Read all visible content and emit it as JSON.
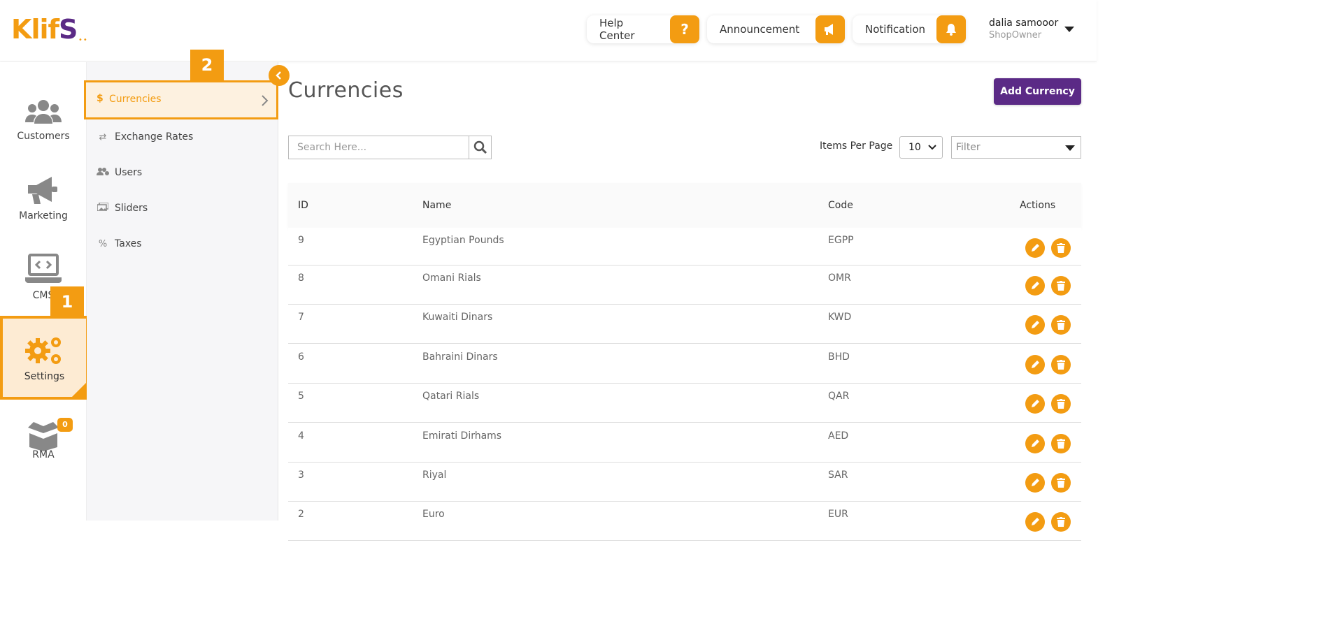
{
  "header": {
    "logo_text": "Klif",
    "logo_s": "S",
    "help_center_label": "Help Center",
    "help_icon_glyph": "?",
    "announcement_label": "Announcement",
    "notification_label": "Notification",
    "user_name": "dalia samooor",
    "user_role": "ShopOwner"
  },
  "rail": {
    "items": [
      {
        "label": "Customers",
        "icon": "users-icon"
      },
      {
        "label": "Marketing",
        "icon": "megaphone-icon"
      },
      {
        "label": "CMS",
        "icon": "laptop-code-icon"
      },
      {
        "label": "Settings",
        "icon": "gears-icon"
      },
      {
        "label": "RMA",
        "icon": "open-box-icon",
        "badge": "0"
      }
    ],
    "selected": "Settings"
  },
  "submenu": {
    "items": [
      {
        "label": "Currencies",
        "icon": "dollar-icon"
      },
      {
        "label": "Exchange Rates",
        "icon": "exchange-icon"
      },
      {
        "label": "Users",
        "icon": "users-cog-icon"
      },
      {
        "label": "Sliders",
        "icon": "images-icon"
      },
      {
        "label": "Taxes",
        "icon": "percent-icon"
      }
    ],
    "selected": "Currencies"
  },
  "steps": {
    "step1": "1",
    "step2": "2"
  },
  "main": {
    "title": "Currencies",
    "add_button": "Add Currency",
    "search_placeholder": "Search Here...",
    "items_per_page_label": "Items Per Page",
    "items_per_page_value": "10",
    "filter_placeholder": "Filter",
    "columns": [
      "ID",
      "Name",
      "Code",
      "Actions"
    ],
    "rows": [
      {
        "id": "9",
        "name": "Egyptian Pounds",
        "code": "EGPP"
      },
      {
        "id": "8",
        "name": "Omani Rials",
        "code": "OMR"
      },
      {
        "id": "7",
        "name": "Kuwaiti Dinars",
        "code": "KWD"
      },
      {
        "id": "6",
        "name": "Bahraini Dinars",
        "code": "BHD"
      },
      {
        "id": "5",
        "name": "Qatari Rials",
        "code": "QAR"
      },
      {
        "id": "4",
        "name": "Emirati Dirhams",
        "code": "AED"
      },
      {
        "id": "3",
        "name": "Riyal",
        "code": "SAR"
      },
      {
        "id": "2",
        "name": "Euro",
        "code": "EUR"
      }
    ]
  },
  "colors": {
    "accent": "#f39c12",
    "brand_purple": "#5b2a86"
  }
}
